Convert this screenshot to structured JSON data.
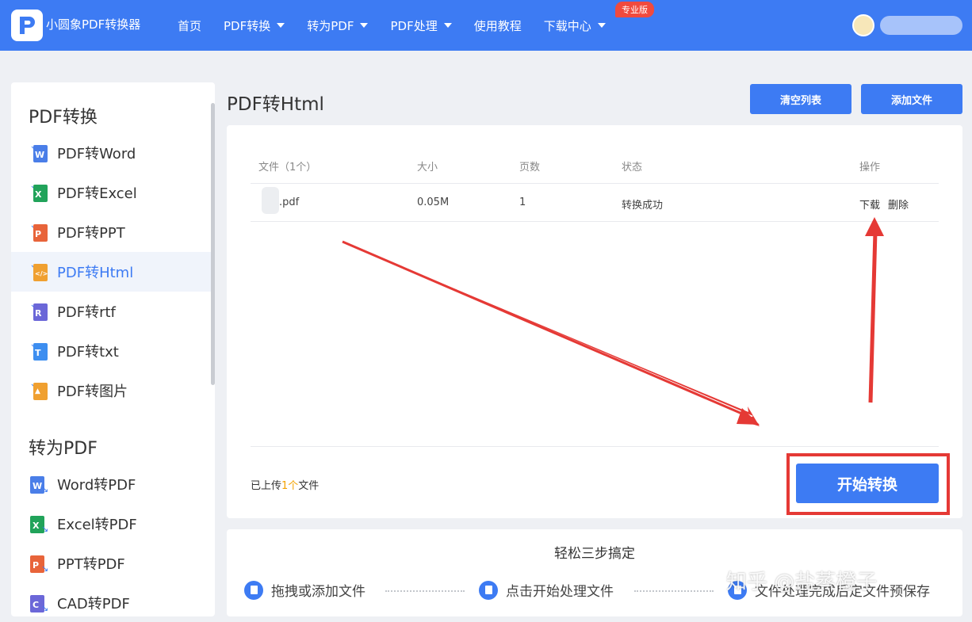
{
  "app": {
    "name": "小圆象PDF转换器",
    "logo_letter": "P"
  },
  "nav": {
    "items": [
      {
        "label": "首页",
        "has_caret": false
      },
      {
        "label": "PDF转换",
        "has_caret": true
      },
      {
        "label": "转为PDF",
        "has_caret": true
      },
      {
        "label": "PDF处理",
        "has_caret": true
      },
      {
        "label": "使用教程",
        "has_caret": false
      },
      {
        "label": "下载中心",
        "has_caret": true
      }
    ],
    "pro_badge": "专业版"
  },
  "sidebar": {
    "section1": {
      "title": "PDF转换",
      "items": [
        {
          "label": "PDF转Word",
          "icon": "word-file-icon",
          "color": "#4a7ee8",
          "letter": "W"
        },
        {
          "label": "PDF转Excel",
          "icon": "excel-file-icon",
          "color": "#21a35a",
          "letter": "X"
        },
        {
          "label": "PDF转PPT",
          "icon": "ppt-file-icon",
          "color": "#e8643a",
          "letter": "P"
        },
        {
          "label": "PDF转Html",
          "icon": "html-file-icon",
          "color": "#f0a030",
          "letter": "</>"
        },
        {
          "label": "PDF转rtf",
          "icon": "rtf-file-icon",
          "color": "#6b67d8",
          "letter": "R"
        },
        {
          "label": "PDF转txt",
          "icon": "txt-file-icon",
          "color": "#3d8ef0",
          "letter": "T"
        },
        {
          "label": "PDF转图片",
          "icon": "image-file-icon",
          "color": "#f0a030",
          "letter": "▲"
        }
      ],
      "active_index": 3
    },
    "section2": {
      "title": "转为PDF",
      "items": [
        {
          "label": "Word转PDF",
          "icon": "word-file-icon",
          "color": "#4a7ee8",
          "letter": "W"
        },
        {
          "label": "Excel转PDF",
          "icon": "excel-file-icon",
          "color": "#21a35a",
          "letter": "X"
        },
        {
          "label": "PPT转PDF",
          "icon": "ppt-file-icon",
          "color": "#e8643a",
          "letter": "P"
        },
        {
          "label": "CAD转PDF",
          "icon": "cad-file-icon",
          "color": "#6b67d8",
          "letter": "C"
        }
      ]
    }
  },
  "main": {
    "title": "PDF转Html",
    "clear_button": "清空列表",
    "add_button": "添加文件",
    "table": {
      "headers": [
        "文件（1个）",
        "大小",
        "页数",
        "状态",
        "操作"
      ],
      "rows": [
        {
          "name": ".pdf",
          "size": "0.05M",
          "pages": "1",
          "status": "转换成功",
          "download": "下载",
          "delete": "删除"
        }
      ]
    },
    "upload_prefix": "已上传",
    "upload_count": "1个",
    "upload_suffix": "文件",
    "start_button": "开始转换"
  },
  "steps": {
    "title": "轻松三步搞定",
    "items": [
      "拖拽或添加文件",
      "点击开始处理文件",
      "文件处理完成后定文件预保存"
    ],
    "watermark": "知乎 @盐蒸橙子"
  },
  "colors": {
    "primary": "#3d7bf3",
    "highlight": "#e53935",
    "count": "#f3a200"
  }
}
